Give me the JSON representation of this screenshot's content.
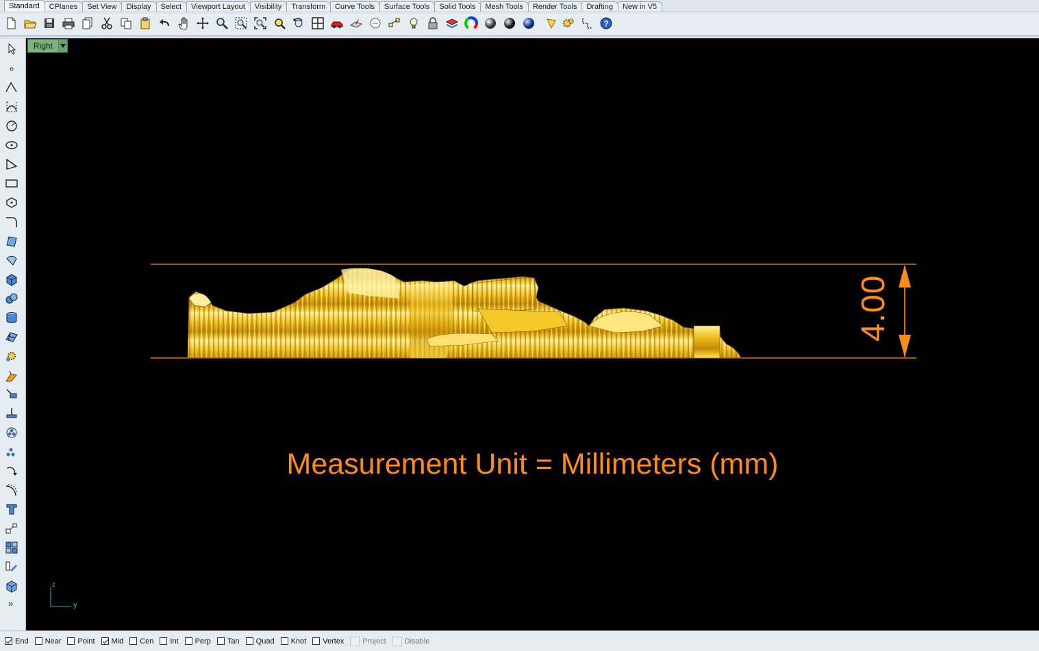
{
  "tabs": [
    "Standard",
    "CPlanes",
    "Set View",
    "Display",
    "Select",
    "Viewport Layout",
    "Visibility",
    "Transform",
    "Curve Tools",
    "Surface Tools",
    "Solid Tools",
    "Mesh Tools",
    "Render Tools",
    "Drafting",
    "New in V5"
  ],
  "active_tab": "Standard",
  "toolbar_icons": [
    "new-file-icon",
    "open-file-icon",
    "save-icon",
    "print-icon",
    "import-icon",
    "cut-icon",
    "copy-icon",
    "paste-icon",
    "undo-icon",
    "pan-hand-icon",
    "rotate-view-icon",
    "zoom-icon",
    "zoom-window-icon",
    "zoom-extents-icon",
    "zoom-selected-icon",
    "undo-view-icon",
    "four-viewports-icon",
    "car-icon",
    "cplane-icon",
    "osnap-icon",
    "select-points-icon",
    "light-bulb-icon",
    "lock-icon",
    "layer-icon",
    "color-wheel-icon",
    "render-sphere-icon",
    "shaded-sphere-icon",
    "material-sphere-icon",
    "render-icon",
    "options-gear-icon",
    "dimension-icon",
    "help-icon"
  ],
  "left_tools": [
    "select-arrow-icon",
    "point-icon",
    "polyline-icon",
    "curve-icon",
    "circle-icon",
    "ellipse-icon",
    "arc-icon",
    "rectangle-icon",
    "polygon-icon",
    "curve-fillet-icon",
    "surface-corners-icon",
    "surface-loft-icon",
    "box-solid-icon",
    "boolean-union-icon",
    "cylinder-solid-icon",
    "mesh-icon",
    "solid-tools-icon",
    "extrude-icon",
    "transform-icon",
    "split-icon",
    "group-icon",
    "array-icon",
    "blend-curve-icon",
    "offset-curve-icon",
    "text-icon",
    "scale-icon",
    "explode-icon",
    "trim-icon",
    "block-icon"
  ],
  "left_more": "»",
  "viewport": {
    "label": "Right",
    "dimension_value": "4.00",
    "unit_note": "Measurement Unit = Millimeters (mm)",
    "axis_z": "z",
    "axis_y": "y",
    "model_color": "#e6b800",
    "annotation_color": "#ff8c1a"
  },
  "snaps": [
    {
      "label": "End",
      "checked": true,
      "enabled": true
    },
    {
      "label": "Near",
      "checked": false,
      "enabled": true
    },
    {
      "label": "Point",
      "checked": false,
      "enabled": true
    },
    {
      "label": "Mid",
      "checked": true,
      "enabled": true
    },
    {
      "label": "Cen",
      "checked": false,
      "enabled": true
    },
    {
      "label": "Int",
      "checked": false,
      "enabled": true
    },
    {
      "label": "Perp",
      "checked": false,
      "enabled": true
    },
    {
      "label": "Tan",
      "checked": false,
      "enabled": true
    },
    {
      "label": "Quad",
      "checked": false,
      "enabled": true
    },
    {
      "label": "Knot",
      "checked": false,
      "enabled": true
    },
    {
      "label": "Vertex",
      "checked": false,
      "enabled": true
    },
    {
      "label": "Project",
      "checked": false,
      "enabled": false
    },
    {
      "label": "Disable",
      "checked": false,
      "enabled": false
    }
  ]
}
